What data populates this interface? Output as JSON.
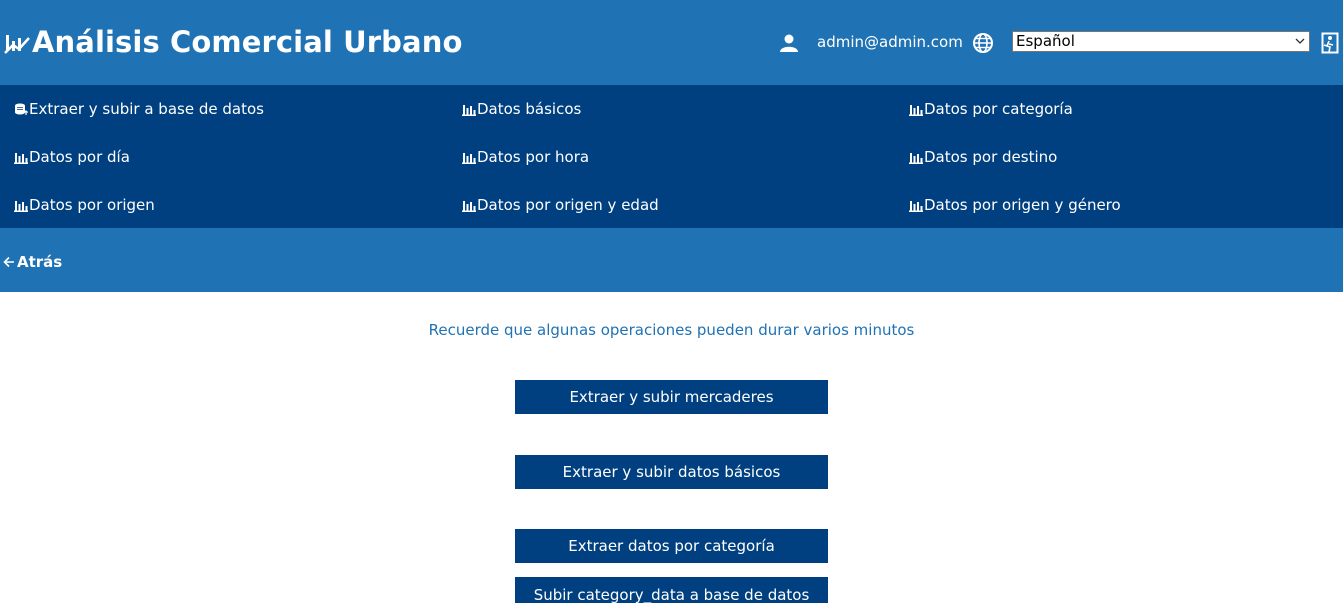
{
  "header": {
    "title": "Análisis Comercial Urbano",
    "logo_icon": "chart-trend-icon",
    "user_icon": "user-icon",
    "user_email": "admin@admin.com",
    "globe_icon": "globe-icon",
    "language_selected": "Español",
    "exit_icon": "exit-icon"
  },
  "menu": {
    "items": [
      {
        "label": "Extraer y subir a base de datos",
        "icon": "database-upload-icon"
      },
      {
        "label": "Datos básicos",
        "icon": "bar-chart-icon"
      },
      {
        "label": "Datos por categoría",
        "icon": "bar-chart-icon"
      },
      {
        "label": "Datos por día",
        "icon": "bar-chart-icon"
      },
      {
        "label": "Datos por hora",
        "icon": "bar-chart-icon"
      },
      {
        "label": "Datos por destino",
        "icon": "bar-chart-icon"
      },
      {
        "label": "Datos por origen",
        "icon": "bar-chart-icon"
      },
      {
        "label": "Datos por origen y edad",
        "icon": "bar-chart-icon"
      },
      {
        "label": "Datos por origen y género",
        "icon": "bar-chart-icon"
      }
    ]
  },
  "back": {
    "label": "Atrás",
    "icon": "arrow-left-icon"
  },
  "main": {
    "notice": "Recuerde que algunas operaciones pueden durar varios minutos",
    "actions": [
      {
        "label": "Extraer y subir mercaderes"
      },
      {
        "label": "Extraer y subir datos básicos"
      },
      {
        "label": "Extraer datos por categoría"
      },
      {
        "label": "Subir category_data a base de datos"
      }
    ]
  },
  "colors": {
    "header_bg": "#1f72b4",
    "menu_bg": "#004080",
    "button_bg": "#004080",
    "notice_text": "#1f72b4"
  }
}
